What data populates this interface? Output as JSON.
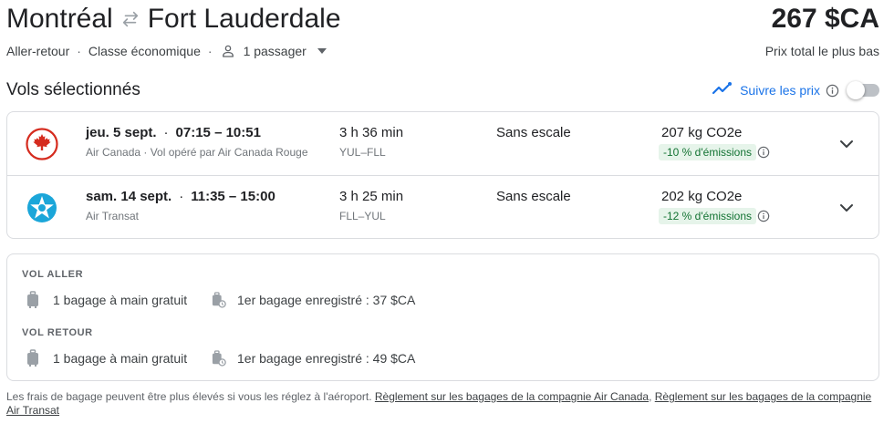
{
  "header": {
    "origin": "Montréal",
    "destination": "Fort Lauderdale",
    "swap_icon": "swap-arrows-icon",
    "total_price": "267 $CA",
    "price_caption": "Prix total le plus bas"
  },
  "options": {
    "trip_type": "Aller-retour",
    "cabin_class": "Classe économique",
    "passengers": "1 passager",
    "separator": "·"
  },
  "section": {
    "title": "Vols sélectionnés",
    "track_label": "Suivre les prix",
    "track_enabled": false,
    "accent_color": "#1a73e8"
  },
  "flights": [
    {
      "date": "jeu. 5 sept.",
      "sep": "·",
      "times": "07:15 – 10:51",
      "airline": "Air Canada · Vol opéré par Air Canada Rouge",
      "duration": "3 h 36 min",
      "airports": "YUL–FLL",
      "stops": "Sans escale",
      "emissions": "207 kg CO2e",
      "emissions_badge": "-10 % d'émissions",
      "logo": "air-canada-logo",
      "logo_color": "#d52b1e"
    },
    {
      "date": "sam. 14 sept.",
      "sep": "·",
      "times": "11:35 – 15:00",
      "airline": "Air Transat",
      "duration": "3 h 25 min",
      "airports": "FLL–YUL",
      "stops": "Sans escale",
      "emissions": "202 kg CO2e",
      "emissions_badge": "-12 % d'émissions",
      "logo": "air-transat-logo",
      "logo_color": "#1ba6d9"
    }
  ],
  "baggage": {
    "outbound": {
      "heading": "VOL ALLER",
      "carry_on": "1 bagage à main gratuit",
      "checked": "1er bagage enregistré : 37 $CA"
    },
    "return": {
      "heading": "VOL RETOUR",
      "carry_on": "1 bagage à main gratuit",
      "checked": "1er bagage enregistré : 49 $CA"
    }
  },
  "footnote": {
    "text": "Les frais de bagage peuvent être plus élevés si vous les réglez à l'aéroport.",
    "link1": "Règlement sur les bagages de la compagnie Air Canada",
    "comma": ",",
    "link2": "Règlement sur les bagages de la compagnie Air Transat"
  }
}
